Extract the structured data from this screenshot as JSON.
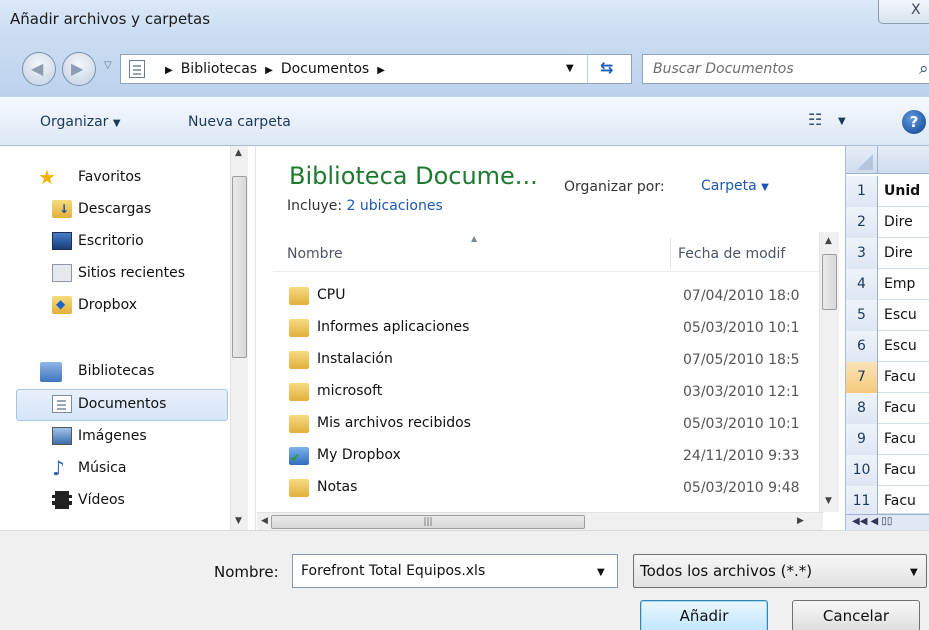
{
  "window": {
    "title": "Añadir archivos y carpetas",
    "close_glyph": "X"
  },
  "address": {
    "crumbs": [
      "Bibliotecas",
      "Documentos"
    ],
    "search_placeholder": "Buscar Documentos"
  },
  "toolbar": {
    "organize": "Organizar",
    "new_folder": "Nueva carpeta"
  },
  "nav": {
    "favorites_label": "Favoritos",
    "favorites": [
      {
        "label": "Descargas",
        "icon": "downloads-icon"
      },
      {
        "label": "Escritorio",
        "icon": "desktop-icon"
      },
      {
        "label": "Sitios recientes",
        "icon": "recent-places-icon"
      },
      {
        "label": "Dropbox",
        "icon": "dropbox-icon"
      }
    ],
    "libraries_label": "Bibliotecas",
    "libraries": [
      {
        "label": "Documentos",
        "icon": "documents-icon",
        "selected": true
      },
      {
        "label": "Imágenes",
        "icon": "pictures-icon"
      },
      {
        "label": "Música",
        "icon": "music-icon"
      },
      {
        "label": "Vídeos",
        "icon": "videos-icon"
      }
    ]
  },
  "library": {
    "title": "Biblioteca Docume...",
    "includes_label": "Incluye:",
    "includes_link": "2 ubicaciones",
    "arrange_label": "Organizar por:",
    "arrange_value": "Carpeta"
  },
  "columns": {
    "name": "Nombre",
    "date": "Fecha de modif"
  },
  "files": [
    {
      "name": "CPU",
      "date": "07/04/2010 18:0",
      "icon": "folder-icon"
    },
    {
      "name": "Informes aplicaciones",
      "date": "05/03/2010 10:1",
      "icon": "folder-icon"
    },
    {
      "name": "Instalación",
      "date": "07/05/2010 18:5",
      "icon": "folder-icon"
    },
    {
      "name": "microsoft",
      "date": "03/03/2010 12:1",
      "icon": "folder-icon"
    },
    {
      "name": "Mis archivos recibidos",
      "date": "05/03/2010 10:1",
      "icon": "folder-icon"
    },
    {
      "name": "My Dropbox",
      "date": "24/11/2010 9:33",
      "icon": "dropbox-sync-folder-icon"
    },
    {
      "name": "Notas",
      "date": "05/03/2010 9:48",
      "icon": "folder-icon"
    }
  ],
  "preview": {
    "rows": [
      {
        "n": "1",
        "text": "Unid",
        "bold": true,
        "active": false
      },
      {
        "n": "2",
        "text": "Dire",
        "bold": false,
        "active": false
      },
      {
        "n": "3",
        "text": "Dire",
        "bold": false,
        "active": false
      },
      {
        "n": "4",
        "text": "Emp",
        "bold": false,
        "active": false
      },
      {
        "n": "5",
        "text": "Escu",
        "bold": false,
        "active": false
      },
      {
        "n": "6",
        "text": "Escu",
        "bold": false,
        "active": false
      },
      {
        "n": "7",
        "text": "Facu",
        "bold": false,
        "active": true
      },
      {
        "n": "8",
        "text": "Facu",
        "bold": false,
        "active": false
      },
      {
        "n": "9",
        "text": "Facu",
        "bold": false,
        "active": false
      },
      {
        "n": "10",
        "text": "Facu",
        "bold": false,
        "active": false
      },
      {
        "n": "11",
        "text": "Facu",
        "bold": false,
        "active": false
      }
    ]
  },
  "bottom": {
    "filename_label": "Nombre:",
    "filename_value": "Forefront Total Equipos.xls",
    "filter_value": "Todos los archivos (*.*)",
    "add_label": "Añadir",
    "cancel_label": "Cancelar"
  }
}
